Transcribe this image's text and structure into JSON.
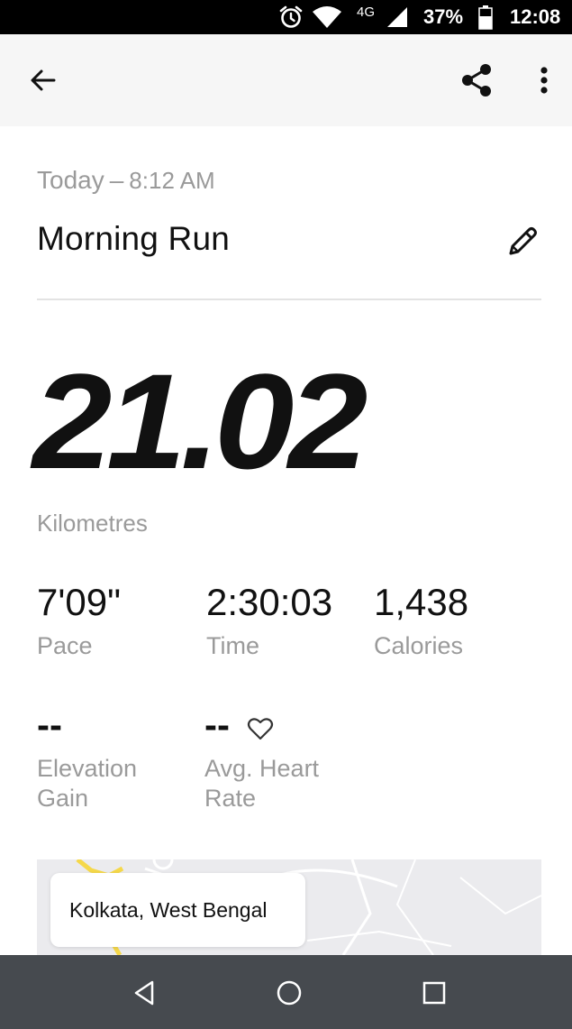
{
  "status_bar": {
    "network": "4G",
    "battery": "37%",
    "time": "12:08",
    "icons": [
      "alarm-icon",
      "wifi-icon",
      "signal-icon",
      "battery-icon"
    ]
  },
  "app_bar": {
    "icons": [
      "back-arrow-icon",
      "share-icon",
      "more-vert-icon"
    ]
  },
  "activity": {
    "day": "Today",
    "separator": "–",
    "time": "8:12 AM",
    "title": "Morning Run",
    "distance": "21.02",
    "distance_unit": "Kilometres"
  },
  "stats": {
    "pace": {
      "value": "7'09\"",
      "label": "Pace"
    },
    "duration": {
      "value": "2:30:03",
      "label": "Time"
    },
    "calories": {
      "value": "1,438",
      "label": "Calories"
    },
    "elevation": {
      "value": "--",
      "label": "Elevation Gain"
    },
    "heart_rate": {
      "value": "--",
      "label": "Avg. Heart Rate",
      "icon": "heart-outline-icon"
    }
  },
  "map": {
    "location": "Kolkata, West Bengal",
    "route_color": "#f5d84a"
  },
  "nav_bar": {
    "icons": [
      "nav-back-icon",
      "nav-home-icon",
      "nav-recents-icon"
    ]
  },
  "colors": {
    "status_bar": "#000000",
    "app_bar": "#f6f6f6",
    "muted_text": "#9a9a9a",
    "nav_bar": "#464a4f"
  }
}
